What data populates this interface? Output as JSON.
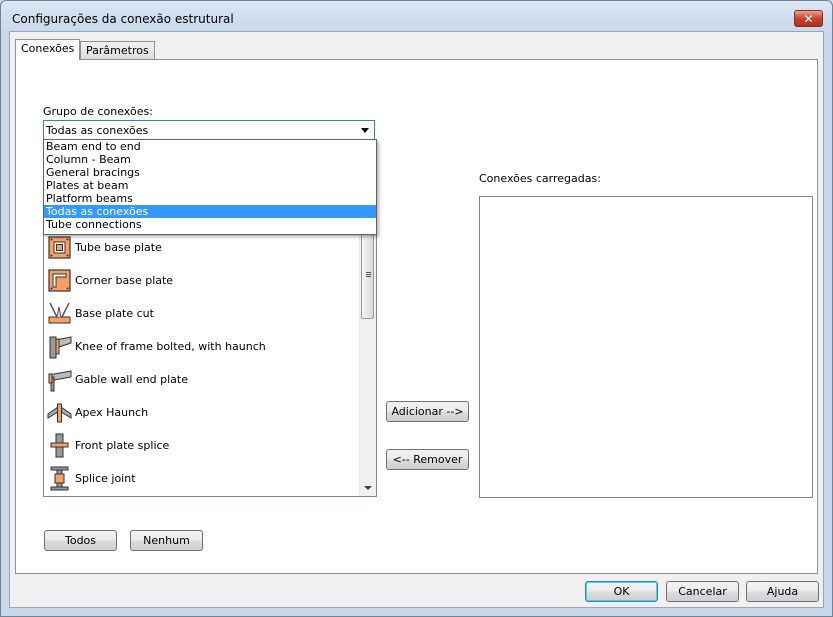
{
  "window": {
    "title": "Configurações da conexão estrutural",
    "close_glyph": "✕"
  },
  "tabs": [
    {
      "label": "Conexões"
    },
    {
      "label": "Parâmetros"
    }
  ],
  "group": {
    "label": "Grupo de conexões:",
    "selected": "Todas as conexões",
    "options": [
      {
        "label": "Beam end to end",
        "selected": false
      },
      {
        "label": "Column - Beam",
        "selected": false
      },
      {
        "label": "General bracings",
        "selected": false
      },
      {
        "label": "Plates at beam",
        "selected": false
      },
      {
        "label": "Platform beams",
        "selected": false
      },
      {
        "label": "Todas as conexões",
        "selected": true
      },
      {
        "label": "Tube connections",
        "selected": false
      }
    ]
  },
  "available": {
    "items": [
      {
        "label": "Tube base plate",
        "icon": "tube-base-plate-icon"
      },
      {
        "label": "Corner base plate",
        "icon": "corner-base-plate-icon"
      },
      {
        "label": "Base plate cut",
        "icon": "base-plate-cut-icon"
      },
      {
        "label": "Knee of frame bolted, with haunch",
        "icon": "knee-of-frame-icon"
      },
      {
        "label": "Gable wall end plate",
        "icon": "gable-wall-end-plate-icon"
      },
      {
        "label": "Apex Haunch",
        "icon": "apex-haunch-icon"
      },
      {
        "label": "Front plate splice",
        "icon": "front-plate-splice-icon"
      },
      {
        "label": "Splice joint",
        "icon": "splice-joint-icon"
      }
    ]
  },
  "loaded": {
    "label": "Conexões carregadas:"
  },
  "buttons": {
    "add": "Adicionar -->",
    "remove": "<-- Remover",
    "all": "Todos",
    "none": "Nenhum",
    "ok": "OK",
    "cancel": "Cancelar",
    "help": "Ajuda"
  },
  "colors": {
    "selection": "#3399ff",
    "icon_fill": "#f4a066"
  }
}
